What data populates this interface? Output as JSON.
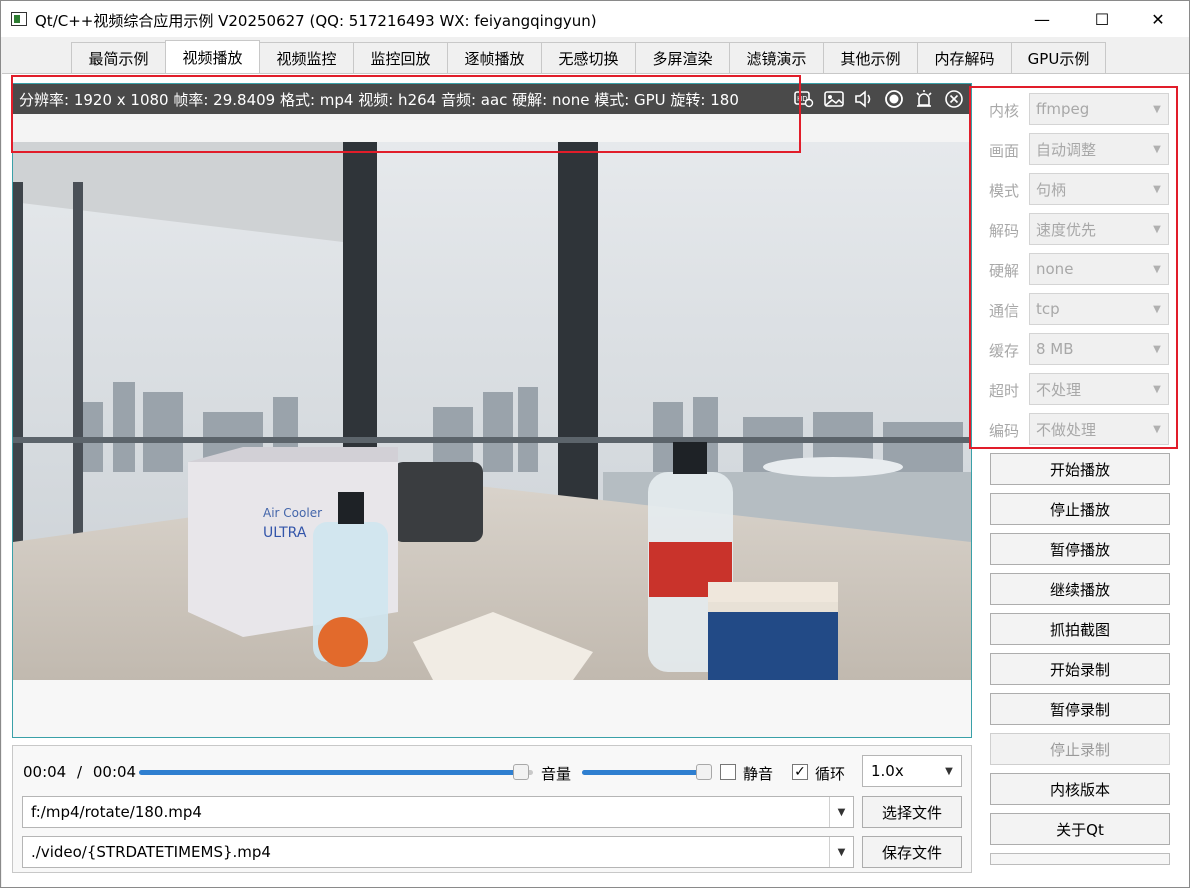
{
  "window": {
    "title": "Qt/C++视频综合应用示例 V20250627 (QQ: 517216493 WX: feiyangqingyun)",
    "min_symbol": "—",
    "max_symbol": "☐",
    "close_symbol": "✕"
  },
  "tabs": [
    {
      "label": "最简示例"
    },
    {
      "label": "视频播放",
      "active": true
    },
    {
      "label": "视频监控"
    },
    {
      "label": "监控回放"
    },
    {
      "label": "逐帧播放"
    },
    {
      "label": "无感切换"
    },
    {
      "label": "多屏渲染"
    },
    {
      "label": "滤镜演示"
    },
    {
      "label": "其他示例"
    },
    {
      "label": "内存解码"
    },
    {
      "label": "GPU示例"
    }
  ],
  "video": {
    "info": "分辨率: 1920 x 1080  帧率: 29.8409  格式: mp4  视频: h264  音频: aac  硬解: none  模式: GPU  旋转: 180",
    "icons": [
      "record-icon",
      "snapshot-icon",
      "volume-icon",
      "capture-icon",
      "alarm-icon",
      "close-circle-icon"
    ]
  },
  "controls": {
    "time_current": "00:04",
    "time_sep": "/",
    "time_total": "00:04",
    "progress": 0.97,
    "volume_label": "音量",
    "volume": 0.99,
    "mute_label": "静音",
    "mute_checked": false,
    "loop_label": "循环",
    "loop_checked": true,
    "speed": "1.0x",
    "file_path": "f:/mp4/rotate/180.mp4",
    "select_file_label": "选择文件",
    "save_path": "./video/{STRDATETIMEMS}.mp4",
    "save_file_label": "保存文件"
  },
  "settings": [
    {
      "label": "内核",
      "value": "ffmpeg"
    },
    {
      "label": "画面",
      "value": "自动调整"
    },
    {
      "label": "模式",
      "value": "句柄"
    },
    {
      "label": "解码",
      "value": "速度优先"
    },
    {
      "label": "硬解",
      "value": "none"
    },
    {
      "label": "通信",
      "value": "tcp"
    },
    {
      "label": "缓存",
      "value": "8 MB"
    },
    {
      "label": "超时",
      "value": "不处理"
    },
    {
      "label": "编码",
      "value": "不做处理"
    }
  ],
  "buttons": [
    {
      "label": "开始播放",
      "enabled": true
    },
    {
      "label": "停止播放",
      "enabled": true
    },
    {
      "label": "暂停播放",
      "enabled": true
    },
    {
      "label": "继续播放",
      "enabled": true
    },
    {
      "label": "抓拍截图",
      "enabled": true
    },
    {
      "label": "开始录制",
      "enabled": true
    },
    {
      "label": "暂停录制",
      "enabled": true
    },
    {
      "label": "停止录制",
      "enabled": false
    },
    {
      "label": "内核版本",
      "enabled": true
    },
    {
      "label": "关于Qt",
      "enabled": true
    }
  ]
}
